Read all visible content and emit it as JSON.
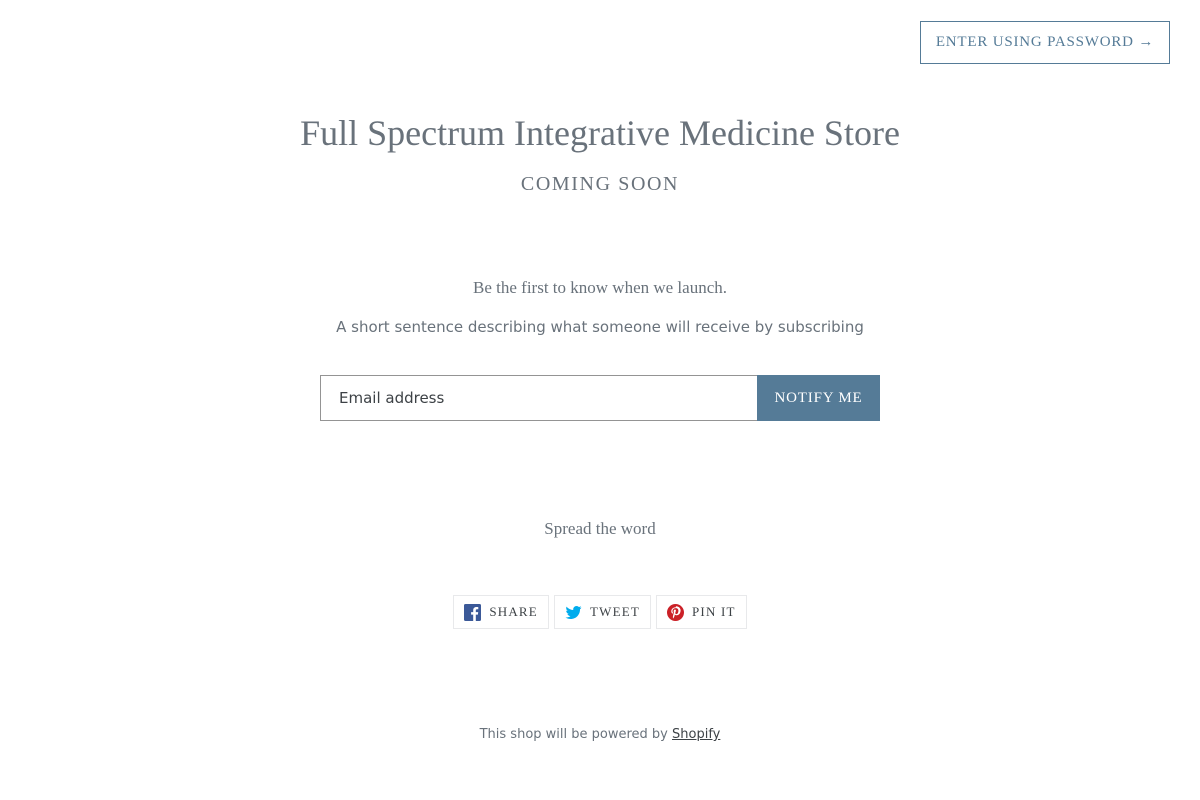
{
  "header": {
    "password_button": "ENTER USING PASSWORD →"
  },
  "store": {
    "title": "Full Spectrum Integrative Medicine Store",
    "status": "COMING SOON"
  },
  "newsletter": {
    "heading": "Be the first to know when we launch.",
    "subtext": "A short sentence describing what someone will receive by subscribing",
    "email_placeholder": "Email address",
    "submit_label": "NOTIFY ME"
  },
  "social": {
    "heading": "Spread the word",
    "buttons": [
      {
        "label": "SHARE",
        "icon": "facebook-icon",
        "color": "#3b5998"
      },
      {
        "label": "TWEET",
        "icon": "twitter-icon",
        "color": "#00aced"
      },
      {
        "label": "PIN IT",
        "icon": "pinterest-icon",
        "color": "#cb2027"
      }
    ]
  },
  "footer": {
    "text": "This shop will be powered by",
    "link": "Shopify"
  },
  "colors": {
    "accent": "#557b97",
    "text": "#69727b",
    "dark_text": "#3d4246"
  }
}
